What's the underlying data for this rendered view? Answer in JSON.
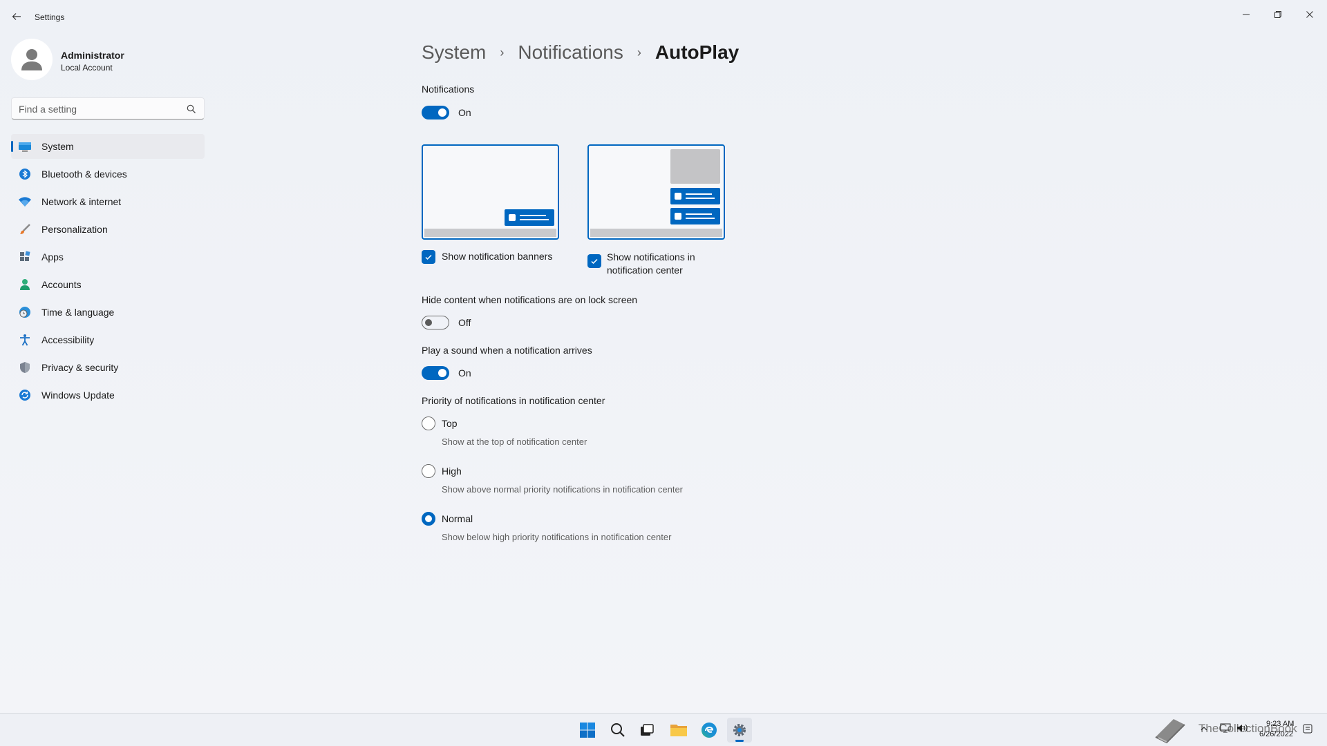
{
  "window": {
    "title": "Settings"
  },
  "user": {
    "name": "Administrator",
    "account_type": "Local Account"
  },
  "search": {
    "placeholder": "Find a setting"
  },
  "sidebar": {
    "items": [
      {
        "label": "System",
        "icon": "monitor-icon",
        "selected": true
      },
      {
        "label": "Bluetooth & devices",
        "icon": "bluetooth-icon"
      },
      {
        "label": "Network & internet",
        "icon": "wifi-icon"
      },
      {
        "label": "Personalization",
        "icon": "brush-icon"
      },
      {
        "label": "Apps",
        "icon": "apps-icon"
      },
      {
        "label": "Accounts",
        "icon": "person-icon"
      },
      {
        "label": "Time & language",
        "icon": "globe-clock-icon"
      },
      {
        "label": "Accessibility",
        "icon": "accessibility-icon"
      },
      {
        "label": "Privacy & security",
        "icon": "shield-icon"
      },
      {
        "label": "Windows Update",
        "icon": "update-icon"
      }
    ]
  },
  "breadcrumb": {
    "level1": "System",
    "level2": "Notifications",
    "current": "AutoPlay",
    "separator": "›"
  },
  "notifications": {
    "label": "Notifications",
    "state": "On"
  },
  "banners": {
    "label": "Show notification banners",
    "checked": true
  },
  "center": {
    "label_line1": "Show notifications in",
    "label_line2": "notification center",
    "checked": true
  },
  "lock_screen": {
    "label": "Hide content when notifications are on lock screen",
    "state": "Off"
  },
  "sound": {
    "label": "Play a sound when a notification arrives",
    "state": "On"
  },
  "priority": {
    "label": "Priority of notifications in notification center",
    "options": [
      {
        "label": "Top",
        "desc": "Show at the top of notification center",
        "checked": false
      },
      {
        "label": "High",
        "desc": "Show above normal priority notifications in notification center",
        "checked": false
      },
      {
        "label": "Normal",
        "desc": "Show below high priority notifications in notification center",
        "checked": true
      }
    ]
  },
  "tray": {
    "time": "9:23 AM",
    "date": "6/26/2022",
    "watermark": "TheCollectionBook"
  },
  "colors": {
    "accent": "#0067c0",
    "background": "#f3f4f7"
  }
}
